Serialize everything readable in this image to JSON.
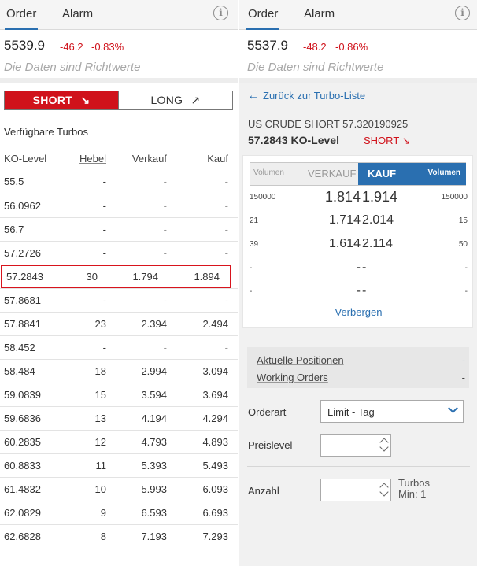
{
  "left": {
    "tabs": [
      {
        "label": "Order"
      },
      {
        "label": "Alarm"
      }
    ],
    "info_icon": "i",
    "quote": {
      "price": "5539.9",
      "change": "-46.2",
      "change_pct": "-0.83%",
      "note": "Die Daten sind Richtwerte"
    },
    "toggle": {
      "short": "SHORT",
      "short_arrow": "↘",
      "long": "LONG",
      "long_arrow": "↗"
    },
    "section_title": "Verfügbare Turbos",
    "table": {
      "headers": {
        "ko": "KO-Level",
        "hebel": "Hebel",
        "verkauf": "Verkauf",
        "kauf": "Kauf"
      },
      "rows": [
        {
          "ko": "55.5",
          "hebel": "-",
          "verkauf": "-",
          "kauf": "-"
        },
        {
          "ko": "56.0962",
          "hebel": "-",
          "verkauf": "-",
          "kauf": "-"
        },
        {
          "ko": "56.7",
          "hebel": "-",
          "verkauf": "-",
          "kauf": "-"
        },
        {
          "ko": "57.2726",
          "hebel": "-",
          "verkauf": "-",
          "kauf": "-"
        },
        {
          "ko": "57.2843",
          "hebel": "30",
          "verkauf": "1.794",
          "kauf": "1.894"
        },
        {
          "ko": "57.8681",
          "hebel": "-",
          "verkauf": "-",
          "kauf": "-"
        },
        {
          "ko": "57.8841",
          "hebel": "23",
          "verkauf": "2.394",
          "kauf": "2.494"
        },
        {
          "ko": "58.452",
          "hebel": "-",
          "verkauf": "-",
          "kauf": "-"
        },
        {
          "ko": "58.484",
          "hebel": "18",
          "verkauf": "2.994",
          "kauf": "3.094"
        },
        {
          "ko": "59.0839",
          "hebel": "15",
          "verkauf": "3.594",
          "kauf": "3.694"
        },
        {
          "ko": "59.6836",
          "hebel": "13",
          "verkauf": "4.194",
          "kauf": "4.294"
        },
        {
          "ko": "60.2835",
          "hebel": "12",
          "verkauf": "4.793",
          "kauf": "4.893"
        },
        {
          "ko": "60.8833",
          "hebel": "11",
          "verkauf": "5.393",
          "kauf": "5.493"
        },
        {
          "ko": "61.4832",
          "hebel": "10",
          "verkauf": "5.993",
          "kauf": "6.093"
        },
        {
          "ko": "62.0829",
          "hebel": "9",
          "verkauf": "6.593",
          "kauf": "6.693"
        },
        {
          "ko": "62.6828",
          "hebel": "8",
          "verkauf": "7.193",
          "kauf": "7.293"
        }
      ]
    }
  },
  "right": {
    "tabs": [
      {
        "label": "Order"
      },
      {
        "label": "Alarm"
      }
    ],
    "info_icon": "i",
    "quote": {
      "price": "5537.9",
      "change": "-48.2",
      "change_pct": "-0.86%",
      "note": "Die Daten sind Richtwerte"
    },
    "back_link": "Zurück zur Turbo-Liste",
    "instrument": {
      "name": "US CRUDE SHORT 57.320190925",
      "ko": "57.2843 KO-Level",
      "direction": "SHORT",
      "direction_arrow": "↘"
    },
    "orderbook": {
      "vol_left": "Volumen",
      "sell_label": "VERKAUF",
      "buy_label": "KAUF",
      "vol_right": "Volumen",
      "rows": [
        {
          "bid_vol": "150000",
          "bid": "1.814",
          "ask": "1.914",
          "ask_vol": "150000"
        },
        {
          "bid_vol": "21",
          "bid": "1.714",
          "ask": "2.014",
          "ask_vol": "15"
        },
        {
          "bid_vol": "39",
          "bid": "1.614",
          "ask": "2.114",
          "ask_vol": "50"
        },
        {
          "bid_vol": "-",
          "bid": "-",
          "ask": "-",
          "ask_vol": "-"
        },
        {
          "bid_vol": "-",
          "bid": "-",
          "ask": "-",
          "ask_vol": "-"
        }
      ],
      "hide_label": "Verbergen"
    },
    "positions": {
      "current_label": "Aktuelle Positionen",
      "current_value": "-",
      "working_label": "Working Orders",
      "working_value": "-"
    },
    "form": {
      "orderart_label": "Orderart",
      "orderart_value": "Limit - Tag",
      "preislevel_label": "Preislevel",
      "preislevel_value": "",
      "anzahl_label": "Anzahl",
      "anzahl_value": "",
      "unit_line1": "Turbos",
      "unit_line2": "Min: 1"
    }
  },
  "colors": {
    "accent": "#2a6fb0",
    "negative": "#d0121b",
    "selection_border": "#d8141d"
  }
}
